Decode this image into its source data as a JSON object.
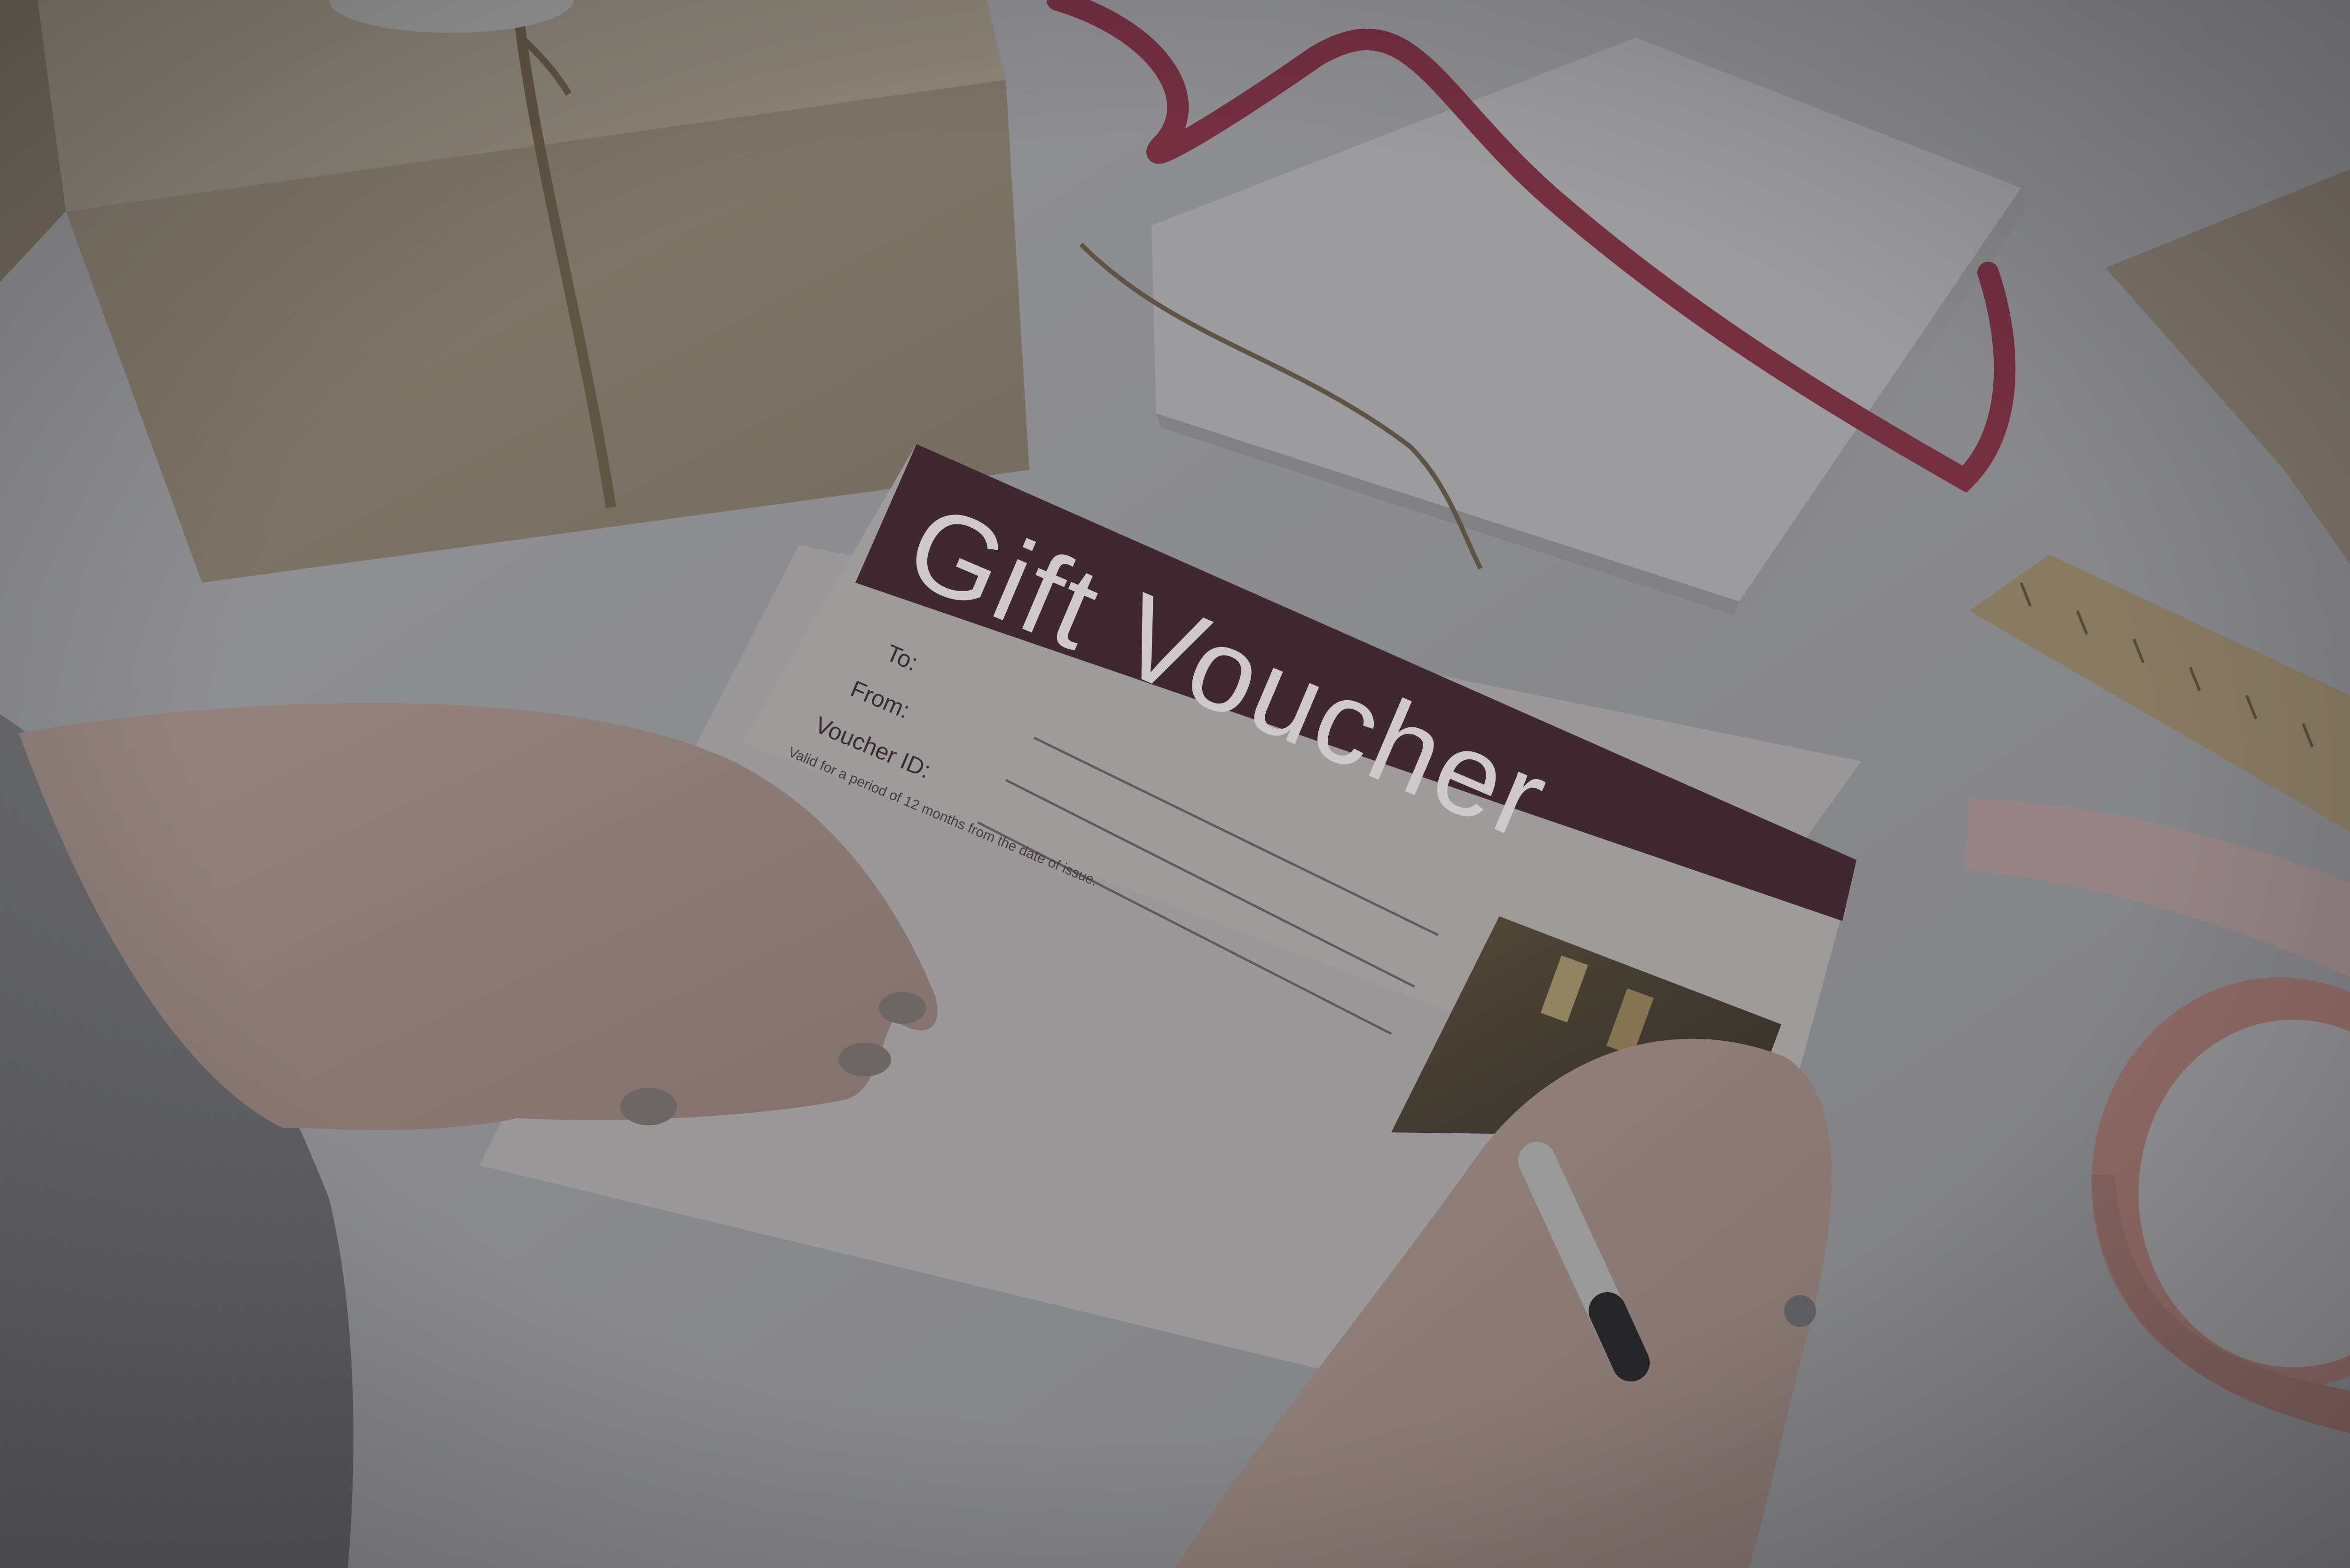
{
  "voucher": {
    "title": "Gift Voucher",
    "to_label": "To:",
    "from_label": "From:",
    "voucher_id_label": "Voucher ID:",
    "validity_note": "Valid for a period of 12 months from the date of issue."
  },
  "colors": {
    "voucher_band": "#4a2530",
    "table": "#bfc0c2",
    "dim_overlay": "#2d2f33"
  }
}
